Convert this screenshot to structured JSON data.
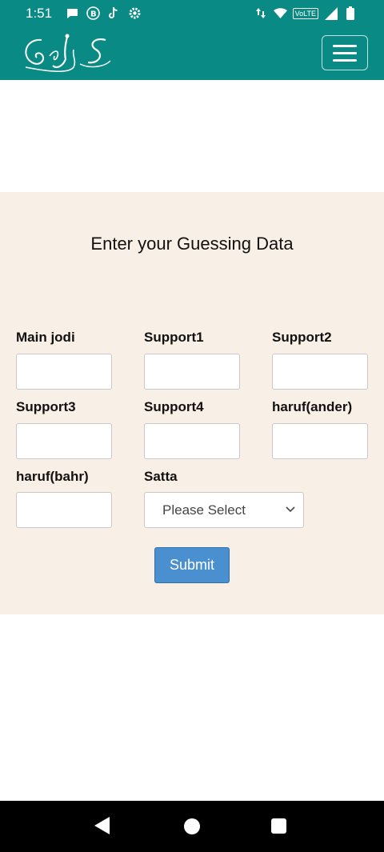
{
  "status_bar": {
    "time": "1:51",
    "volte_label": "VoLTE",
    "icons": [
      "chat-bubble-icon",
      "b-badge-icon",
      "tiktok-icon",
      "settings-icon",
      "data-arrows-icon",
      "wifi-icon",
      "signal-icon",
      "battery-icon"
    ]
  },
  "app_bar": {
    "logo_text": "GAS",
    "menu_icon": "hamburger-menu-icon"
  },
  "form": {
    "title": "Enter your Guessing Data",
    "fields": [
      {
        "label": "Main jodi",
        "value": ""
      },
      {
        "label": "Support1",
        "value": ""
      },
      {
        "label": "Support2",
        "value": ""
      },
      {
        "label": "Support3",
        "value": ""
      },
      {
        "label": "Support4",
        "value": ""
      },
      {
        "label": "haruf(ander)",
        "value": ""
      },
      {
        "label": "haruf(bahr)",
        "value": ""
      }
    ],
    "satta_label": "Satta",
    "satta_selected": "Please Select",
    "submit_label": "Submit"
  },
  "colors": {
    "brand": "#0a8a84",
    "form_background": "#f8efe6",
    "submit": "#4a8fd0"
  }
}
